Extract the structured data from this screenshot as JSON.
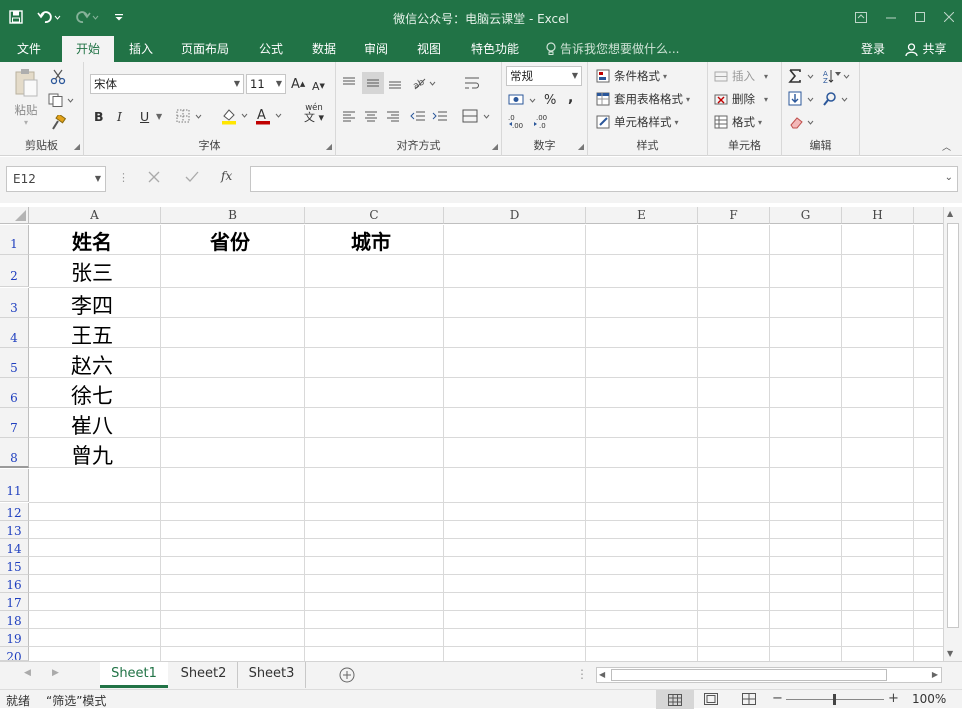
{
  "titlebar": {
    "title": "微信公众号：电脑云课堂 - Excel",
    "save_icon": "save-icon",
    "undo_icon": "undo-icon",
    "redo_icon": "redo-icon"
  },
  "tabs": [
    "文件",
    "开始",
    "插入",
    "页面布局",
    "公式",
    "数据",
    "审阅",
    "视图",
    "特色功能"
  ],
  "tell_me": "告诉我您想要做什么...",
  "login": "登录",
  "share": "共享",
  "ribbon": {
    "clipboard": {
      "label": "剪贴板",
      "paste": "粘贴"
    },
    "font": {
      "label": "字体",
      "family": "宋体",
      "size": "11",
      "bold": "B",
      "italic": "I",
      "underline": "U",
      "wen": "wén"
    },
    "alignment": {
      "label": "对齐方式"
    },
    "number": {
      "label": "数字",
      "format": "常规",
      "percent": "%",
      "comma": ","
    },
    "styles": {
      "label": "样式",
      "conditional": "条件格式",
      "table_format": "套用表格格式",
      "cell_style": "单元格样式"
    },
    "cells": {
      "label": "单元格",
      "insert": "插入",
      "delete": "删除",
      "format": "格式"
    },
    "editing": {
      "label": "编辑"
    }
  },
  "formula_bar": {
    "name_box": "E12",
    "formula": "",
    "fx": "fx"
  },
  "columns": [
    "A",
    "B",
    "C",
    "D",
    "E",
    "F",
    "G",
    "H"
  ],
  "row_numbers": [
    "1",
    "2",
    "3",
    "4",
    "5",
    "6",
    "7",
    "8",
    "11",
    "12",
    "13",
    "14",
    "15",
    "16",
    "17",
    "18",
    "19",
    "20"
  ],
  "cells": {
    "A1": "姓名",
    "B1": "省份",
    "C1": "城市",
    "A2": "张三",
    "A3": "李四",
    "A4": "王五",
    "A5": "赵六",
    "A6": "徐七",
    "A7": "崔八",
    "A8": "曾九"
  },
  "sheets": [
    "Sheet1",
    "Sheet2",
    "Sheet3"
  ],
  "active_sheet": "Sheet1",
  "status": {
    "ready": "就绪",
    "mode": "“筛选”模式",
    "zoom": "100%"
  },
  "colors": {
    "accent": "#217346",
    "row_number": "#1f3fbf"
  }
}
